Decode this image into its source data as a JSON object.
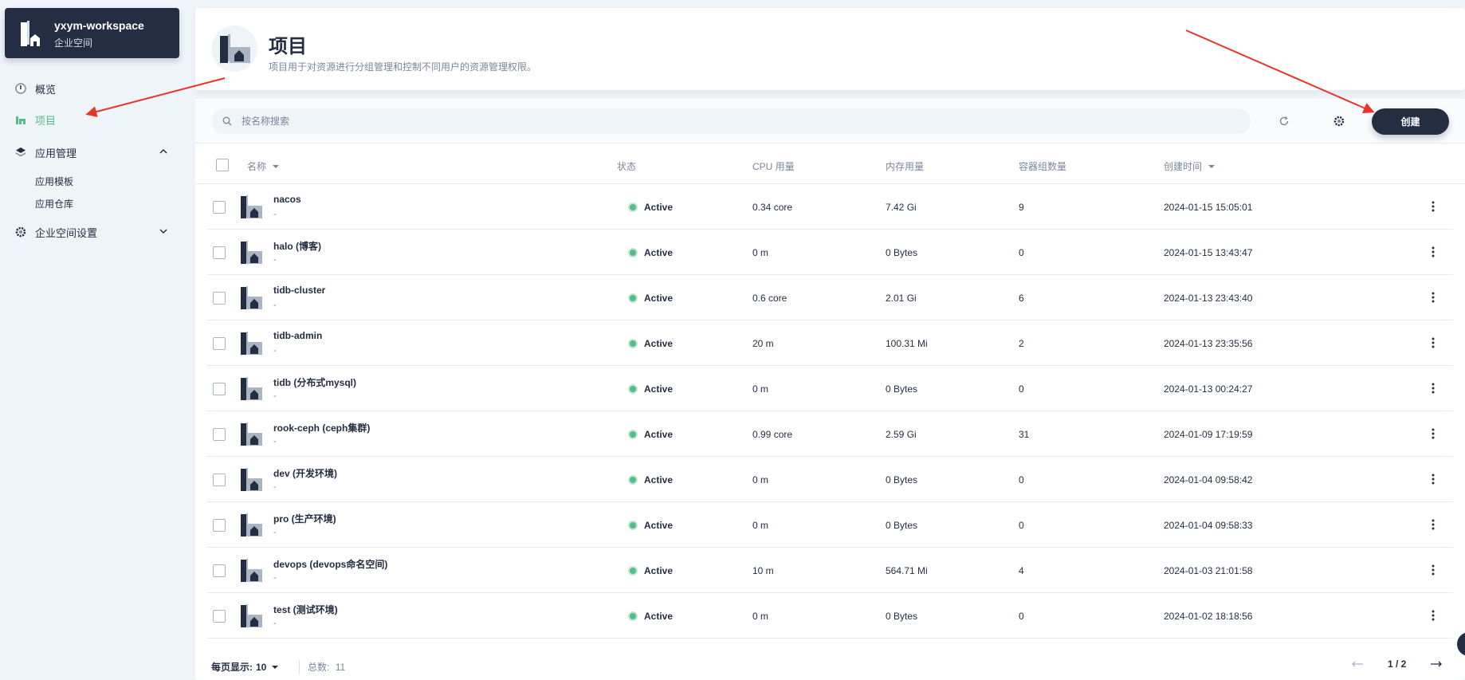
{
  "workspace": {
    "name": "yxym-workspace",
    "type": "企业空间"
  },
  "nav": {
    "overview": "概览",
    "projects": "项目",
    "app_management": "应用管理",
    "app_templates": "应用模板",
    "app_repos": "应用仓库",
    "workspace_settings": "企业空间设置"
  },
  "header": {
    "title": "项目",
    "description": "项目用于对资源进行分组管理和控制不同用户的资源管理权限。"
  },
  "toolbar": {
    "search_placeholder": "按名称搜索",
    "create_label": "创建"
  },
  "table": {
    "columns": {
      "name": "名称",
      "status": "状态",
      "cpu": "CPU 用量",
      "memory": "内存用量",
      "pods": "容器组数量",
      "created": "创建时间"
    },
    "rows": [
      {
        "name": "nacos",
        "desc": "-",
        "status": "Active",
        "cpu": "0.34 core",
        "memory": "7.42 Gi",
        "pods": "9",
        "created": "2024-01-15 15:05:01"
      },
      {
        "name": "halo (博客)",
        "desc": "-",
        "status": "Active",
        "cpu": "0 m",
        "memory": "0 Bytes",
        "pods": "0",
        "created": "2024-01-15 13:43:47"
      },
      {
        "name": "tidb-cluster",
        "desc": "-",
        "status": "Active",
        "cpu": "0.6 core",
        "memory": "2.01 Gi",
        "pods": "6",
        "created": "2024-01-13 23:43:40"
      },
      {
        "name": "tidb-admin",
        "desc": "-",
        "status": "Active",
        "cpu": "20 m",
        "memory": "100.31 Mi",
        "pods": "2",
        "created": "2024-01-13 23:35:56"
      },
      {
        "name": "tidb (分布式mysql)",
        "desc": "-",
        "status": "Active",
        "cpu": "0 m",
        "memory": "0 Bytes",
        "pods": "0",
        "created": "2024-01-13 00:24:27"
      },
      {
        "name": "rook-ceph (ceph集群)",
        "desc": "-",
        "status": "Active",
        "cpu": "0.99 core",
        "memory": "2.59 Gi",
        "pods": "31",
        "created": "2024-01-09 17:19:59"
      },
      {
        "name": "dev (开发环境)",
        "desc": "-",
        "status": "Active",
        "cpu": "0 m",
        "memory": "0 Bytes",
        "pods": "0",
        "created": "2024-01-04 09:58:42"
      },
      {
        "name": "pro (生产环境)",
        "desc": "-",
        "status": "Active",
        "cpu": "0 m",
        "memory": "0 Bytes",
        "pods": "0",
        "created": "2024-01-04 09:58:33"
      },
      {
        "name": "devops (devops命名空间)",
        "desc": "-",
        "status": "Active",
        "cpu": "10 m",
        "memory": "564.71 Mi",
        "pods": "4",
        "created": "2024-01-03 21:01:58"
      },
      {
        "name": "test (测试环境)",
        "desc": "-",
        "status": "Active",
        "cpu": "0 m",
        "memory": "0 Bytes",
        "pods": "0",
        "created": "2024-01-02 18:18:56"
      }
    ]
  },
  "footer": {
    "per_page_label": "每页显示:",
    "per_page_value": "10",
    "total_label": "总数:",
    "total_value": "11",
    "page": "1 / 2"
  },
  "colors": {
    "accent": "#55bc8a",
    "dark": "#242e42",
    "arrow": "#e8342b"
  }
}
